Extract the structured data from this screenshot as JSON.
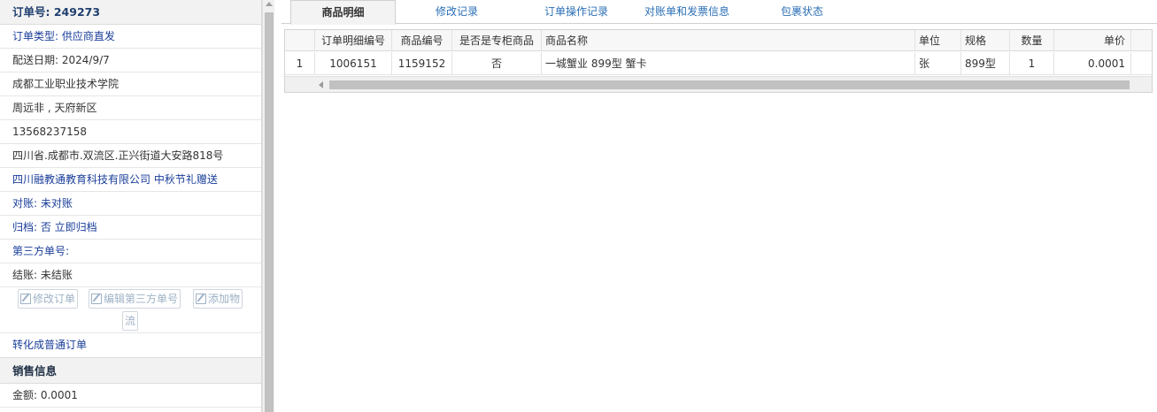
{
  "order": {
    "title": "订单号: 249273"
  },
  "info_rows": [
    {
      "label": "订单类型: ",
      "value": "供应商直发"
    },
    {
      "text": "配送日期: 2024/9/7"
    },
    {
      "text": "成都工业职业技术学院"
    },
    {
      "text": "周远非 , 天府新区"
    },
    {
      "text": "13568237158"
    },
    {
      "text": "四川省.成都市.双流区.正兴街道大安路818号"
    },
    {
      "text": "四川融教通教育科技有限公司 中秋节礼赠送"
    },
    {
      "label": "对账: ",
      "value": "未对账"
    },
    {
      "label": "归档: ",
      "value": " 否 立即归档"
    },
    {
      "label": "第三方单号: ",
      "value": ""
    },
    {
      "text": "结账: 未结账"
    }
  ],
  "buttons": {
    "edit_order": "修改订单",
    "edit_third": "编辑第三方单号",
    "add_logistics_1": "添加物",
    "add_logistics_2": "流"
  },
  "convert_link": "转化成普通订单",
  "sales_section": {
    "title": "销售信息",
    "amount": "金额: 0.0001"
  },
  "tabs": [
    "商品明细",
    "修改记录",
    "订单操作记录",
    "对账单和发票信息",
    "包裹状态"
  ],
  "grid": {
    "columns": [
      "",
      "订单明细编号",
      "商品编号",
      "是否是专柜商品",
      "商品名称",
      "单位",
      "规格",
      "数量",
      "单价"
    ],
    "rows": [
      {
        "idx": "1",
        "detail_id": "1006151",
        "product_id": "1159152",
        "counter": "否",
        "name": "一城蟹业 899型 蟹卡",
        "unit": "张",
        "spec": "899型",
        "qty": "1",
        "price": "0.0001"
      }
    ]
  },
  "colors": {
    "accent": "#1a3e9a",
    "tab_link": "#2b6fb6"
  },
  "icons": [
    "edit-icon",
    "scroll-up-icon",
    "scroll-left-icon"
  ]
}
